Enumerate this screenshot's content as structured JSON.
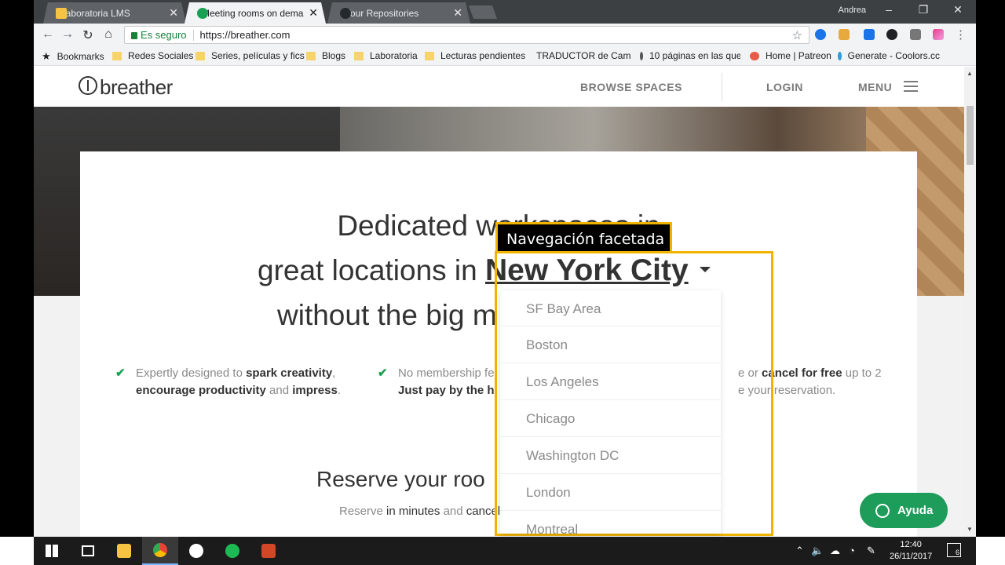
{
  "browser": {
    "tabs": [
      {
        "label": "Laboratoria LMS",
        "favicon_color": "#f6c343"
      },
      {
        "label": "Meeting rooms on dema",
        "favicon_color": "#1aa053"
      },
      {
        "label": "Your Repositories",
        "favicon_color": "#24292e"
      }
    ],
    "user_name": "Andrea",
    "window_controls": {
      "minimize": "–",
      "maximize": "❐",
      "close": "✕"
    },
    "secure_label": "Es seguro",
    "url": "https://breather.com",
    "bookmarks": [
      {
        "label": "Bookmarks",
        "icon": "star-icon"
      },
      {
        "label": "Redes Sociales",
        "icon": "folder-icon"
      },
      {
        "label": "Series, películas y fics",
        "icon": "folder-icon"
      },
      {
        "label": "Blogs",
        "icon": "folder-icon"
      },
      {
        "label": "Laboratoria",
        "icon": "folder-icon"
      },
      {
        "label": "Lecturas pendientes",
        "icon": "folder-icon"
      },
      {
        "label": "TRADUCTOR de Cam",
        "icon": "crest-icon"
      },
      {
        "label": "10 páginas en las que",
        "icon": "recycle-icon"
      },
      {
        "label": "Home | Patreon",
        "icon": "patreon-icon"
      },
      {
        "label": "Generate - Coolors.cc",
        "icon": "coolors-icon"
      }
    ]
  },
  "site": {
    "logo": "breather",
    "nav": {
      "browse": "BROWSE SPACES",
      "login": "LOGIN",
      "menu": "MENU"
    },
    "headline": {
      "line1": "Dedicated workspaces in",
      "line2_prefix": "great locations in",
      "city": "New York City",
      "line3": "without the big m"
    },
    "features": [
      {
        "pre": "Expertly designed to ",
        "b1": "spark creativity",
        "mid": ",",
        "b2": "encourage productivity",
        "post": " and ",
        "b3": "impress",
        "end": "."
      },
      {
        "pre": "No membership fe",
        "b1": "Just pay by the h"
      },
      {
        "pre": "e or ",
        "b1": "cancel for free",
        "post": " up to 2",
        "line2": "e your reservation."
      }
    ],
    "reserve": {
      "title": "Reserve your roo",
      "sub_pre": "Reserve ",
      "sub_b1": "in minutes",
      "sub_mid": " and ",
      "sub_b2": "cancel"
    },
    "annotation_label": "Navegación facetada",
    "city_options": [
      "SF Bay Area",
      "Boston",
      "Los Angeles",
      "Chicago",
      "Washington DC",
      "London",
      "Montreal"
    ],
    "help_button": "Ayuda"
  },
  "taskbar": {
    "clock_time": "12:40",
    "clock_date": "26/11/2017",
    "notification_count": "6"
  }
}
